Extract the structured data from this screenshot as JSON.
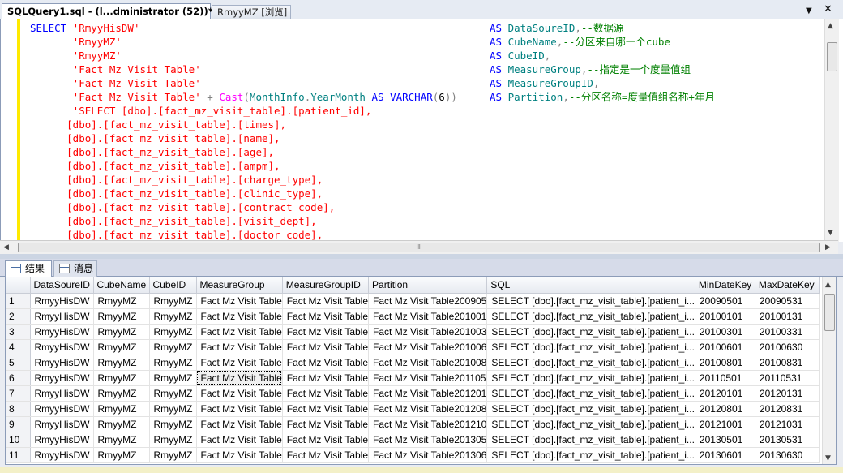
{
  "tabs": [
    {
      "label": "SQLQuery1.sql - (l...dministrator (52))*"
    },
    {
      "label": "RmyyMZ [浏览]"
    }
  ],
  "window_controls": {
    "dropdown": "▼",
    "close": "✕"
  },
  "editor": {
    "lines": [
      {
        "segs": [
          [
            "kw",
            "SELECT "
          ],
          [
            "str",
            "'RmyyHisDW'"
          ]
        ],
        "as": [
          [
            "kw",
            "AS "
          ],
          [
            "tea",
            "DataSoureID"
          ],
          [
            "gray",
            ","
          ],
          [
            "cmt",
            "--数据源"
          ]
        ]
      },
      {
        "segs": [
          [
            "",
            "       "
          ],
          [
            "str",
            "'RmyyMZ'"
          ]
        ],
        "as": [
          [
            "kw",
            "AS "
          ],
          [
            "tea",
            "CubeName"
          ],
          [
            "gray",
            ","
          ],
          [
            "cmt",
            "--分区来自哪一个cube"
          ]
        ]
      },
      {
        "segs": [
          [
            "",
            "       "
          ],
          [
            "str",
            "'RmyyMZ'"
          ]
        ],
        "as": [
          [
            "kw",
            "AS "
          ],
          [
            "tea",
            "CubeID"
          ],
          [
            "gray",
            ","
          ]
        ]
      },
      {
        "segs": [
          [
            "",
            "       "
          ],
          [
            "str",
            "'Fact Mz Visit Table'"
          ]
        ],
        "as": [
          [
            "kw",
            "AS "
          ],
          [
            "tea",
            "MeasureGroup"
          ],
          [
            "gray",
            ","
          ],
          [
            "cmt",
            "--指定是一个度量值组"
          ]
        ]
      },
      {
        "segs": [
          [
            "",
            "       "
          ],
          [
            "str",
            "'Fact Mz Visit Table'"
          ]
        ],
        "as": [
          [
            "kw",
            "AS "
          ],
          [
            "tea",
            "MeasureGroupID"
          ],
          [
            "gray",
            ","
          ]
        ]
      },
      {
        "segs": [
          [
            "",
            "       "
          ],
          [
            "str",
            "'Fact Mz Visit Table'"
          ],
          [
            "gray",
            " + "
          ],
          [
            "fn",
            "Cast"
          ],
          [
            "gray",
            "("
          ],
          [
            "tea",
            "MonthInfo"
          ],
          [
            "gray",
            "."
          ],
          [
            "tea",
            "YearMonth "
          ],
          [
            "kw",
            "AS "
          ],
          [
            "kw",
            "VARCHAR"
          ],
          [
            "gray",
            "("
          ],
          [
            "",
            "6"
          ],
          [
            "gray",
            "))"
          ]
        ],
        "as": [
          [
            "kw",
            "AS "
          ],
          [
            "tea",
            "Partition"
          ],
          [
            "gray",
            ","
          ],
          [
            "cmt",
            "--分区名称=度量值组名称+年月"
          ]
        ]
      },
      {
        "segs": [
          [
            "",
            "       "
          ],
          [
            "str",
            "'SELECT [dbo].[fact_mz_visit_table].[patient_id],"
          ]
        ],
        "as": []
      },
      {
        "segs": [
          [
            "",
            "      "
          ],
          [
            "str",
            "[dbo].[fact_mz_visit_table].[times],"
          ]
        ],
        "as": []
      },
      {
        "segs": [
          [
            "",
            "      "
          ],
          [
            "str",
            "[dbo].[fact_mz_visit_table].[name],"
          ]
        ],
        "as": []
      },
      {
        "segs": [
          [
            "",
            "      "
          ],
          [
            "str",
            "[dbo].[fact_mz_visit_table].[age],"
          ]
        ],
        "as": []
      },
      {
        "segs": [
          [
            "",
            "      "
          ],
          [
            "str",
            "[dbo].[fact_mz_visit_table].[ampm],"
          ]
        ],
        "as": []
      },
      {
        "segs": [
          [
            "",
            "      "
          ],
          [
            "str",
            "[dbo].[fact_mz_visit_table].[charge_type],"
          ]
        ],
        "as": []
      },
      {
        "segs": [
          [
            "",
            "      "
          ],
          [
            "str",
            "[dbo].[fact_mz_visit_table].[clinic_type],"
          ]
        ],
        "as": []
      },
      {
        "segs": [
          [
            "",
            "      "
          ],
          [
            "str",
            "[dbo].[fact_mz_visit_table].[contract_code],"
          ]
        ],
        "as": []
      },
      {
        "segs": [
          [
            "",
            "      "
          ],
          [
            "str",
            "[dbo].[fact_mz_visit_table].[visit_dept],"
          ]
        ],
        "as": []
      },
      {
        "segs": [
          [
            "",
            "      "
          ],
          [
            "str",
            "[dbo].[fact_mz_visit_table].[doctor_code],"
          ]
        ],
        "as": []
      }
    ]
  },
  "hscroll_grip": "III",
  "results_tabs": [
    {
      "label": "结果"
    },
    {
      "label": "消息"
    }
  ],
  "grid": {
    "columns": [
      "",
      "DataSoureID",
      "CubeName",
      "CubeID",
      "MeasureGroup",
      "MeasureGroupID",
      "Partition",
      "SQL",
      "MinDateKey",
      "MaxDateKey"
    ],
    "rows": [
      [
        "1",
        "RmyyHisDW",
        "RmyyMZ",
        "RmyyMZ",
        "Fact Mz Visit Table",
        "Fact Mz Visit Table",
        "Fact Mz Visit Table200905",
        "SELECT [dbo].[fact_mz_visit_table].[patient_i...",
        "20090501",
        "20090531"
      ],
      [
        "2",
        "RmyyHisDW",
        "RmyyMZ",
        "RmyyMZ",
        "Fact Mz Visit Table",
        "Fact Mz Visit Table",
        "Fact Mz Visit Table201001",
        "SELECT [dbo].[fact_mz_visit_table].[patient_i...",
        "20100101",
        "20100131"
      ],
      [
        "3",
        "RmyyHisDW",
        "RmyyMZ",
        "RmyyMZ",
        "Fact Mz Visit Table",
        "Fact Mz Visit Table",
        "Fact Mz Visit Table201003",
        "SELECT [dbo].[fact_mz_visit_table].[patient_i...",
        "20100301",
        "20100331"
      ],
      [
        "4",
        "RmyyHisDW",
        "RmyyMZ",
        "RmyyMZ",
        "Fact Mz Visit Table",
        "Fact Mz Visit Table",
        "Fact Mz Visit Table201006",
        "SELECT [dbo].[fact_mz_visit_table].[patient_i...",
        "20100601",
        "20100630"
      ],
      [
        "5",
        "RmyyHisDW",
        "RmyyMZ",
        "RmyyMZ",
        "Fact Mz Visit Table",
        "Fact Mz Visit Table",
        "Fact Mz Visit Table201008",
        "SELECT [dbo].[fact_mz_visit_table].[patient_i...",
        "20100801",
        "20100831"
      ],
      [
        "6",
        "RmyyHisDW",
        "RmyyMZ",
        "RmyyMZ",
        "Fact Mz Visit Table",
        "Fact Mz Visit Table",
        "Fact Mz Visit Table201105",
        "SELECT [dbo].[fact_mz_visit_table].[patient_i...",
        "20110501",
        "20110531"
      ],
      [
        "7",
        "RmyyHisDW",
        "RmyyMZ",
        "RmyyMZ",
        "Fact Mz Visit Table",
        "Fact Mz Visit Table",
        "Fact Mz Visit Table201201",
        "SELECT [dbo].[fact_mz_visit_table].[patient_i...",
        "20120101",
        "20120131"
      ],
      [
        "8",
        "RmyyHisDW",
        "RmyyMZ",
        "RmyyMZ",
        "Fact Mz Visit Table",
        "Fact Mz Visit Table",
        "Fact Mz Visit Table201208",
        "SELECT [dbo].[fact_mz_visit_table].[patient_i...",
        "20120801",
        "20120831"
      ],
      [
        "9",
        "RmyyHisDW",
        "RmyyMZ",
        "RmyyMZ",
        "Fact Mz Visit Table",
        "Fact Mz Visit Table",
        "Fact Mz Visit Table201210",
        "SELECT [dbo].[fact_mz_visit_table].[patient_i...",
        "20121001",
        "20121031"
      ],
      [
        "10",
        "RmyyHisDW",
        "RmyyMZ",
        "RmyyMZ",
        "Fact Mz Visit Table",
        "Fact Mz Visit Table",
        "Fact Mz Visit Table201305",
        "SELECT [dbo].[fact_mz_visit_table].[patient_i...",
        "20130501",
        "20130531"
      ],
      [
        "11",
        "RmyyHisDW",
        "RmyyMZ",
        "RmyyMZ",
        "Fact Mz Visit Table",
        "Fact Mz Visit Table",
        "Fact Mz Visit Table201306",
        "SELECT [dbo].[fact_mz_visit_table].[patient_i...",
        "20130601",
        "20130630"
      ]
    ],
    "selected_cell": {
      "row": 5,
      "col": 4
    }
  },
  "colors": {
    "editor_margin": "#ffea00",
    "keyword": "#0000ff",
    "string": "#ff0000",
    "comment": "#008000",
    "identifier": "#008080",
    "function": "#ff00ff"
  }
}
